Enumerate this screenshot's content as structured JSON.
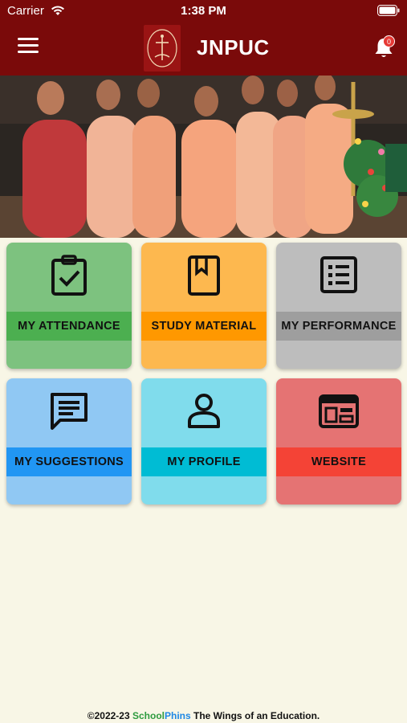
{
  "status_bar": {
    "carrier": "Carrier",
    "time": "1:38 PM"
  },
  "header": {
    "title": "JNPUC",
    "notification_count": "0",
    "menu_icon": "hamburger-menu-icon",
    "bell_icon": "bell-icon",
    "background_color": "#7a0a0a"
  },
  "banner": {
    "description_icon": "banner-photo"
  },
  "tiles": [
    {
      "label": "MY ATTENDANCE",
      "icon": "clipboard-check-icon",
      "bg": "#7dc27f",
      "bar": "#4caf50"
    },
    {
      "label": "STUDY MATERIAL",
      "icon": "bookmark-book-icon",
      "bg": "#fdb84f",
      "bar": "#ff9800"
    },
    {
      "label": "MY PERFORMANCE",
      "icon": "list-icon",
      "bg": "#bdbdbd",
      "bar": "#9e9e9e"
    },
    {
      "label": "MY SUGGESTIONS",
      "icon": "chat-message-icon",
      "bg": "#90c8f3",
      "bar": "#2196f3"
    },
    {
      "label": "MY PROFILE",
      "icon": "user-profile-icon",
      "bg": "#80dcec",
      "bar": "#00bcd4"
    },
    {
      "label": "WEBSITE",
      "icon": "browser-window-icon",
      "bg": "#e57373",
      "bar": "#f44336"
    }
  ],
  "footer": {
    "copyright": "©2022-23",
    "brand_school": "School",
    "brand_phins": "Phins",
    "tagline": "The Wings of an Education."
  }
}
